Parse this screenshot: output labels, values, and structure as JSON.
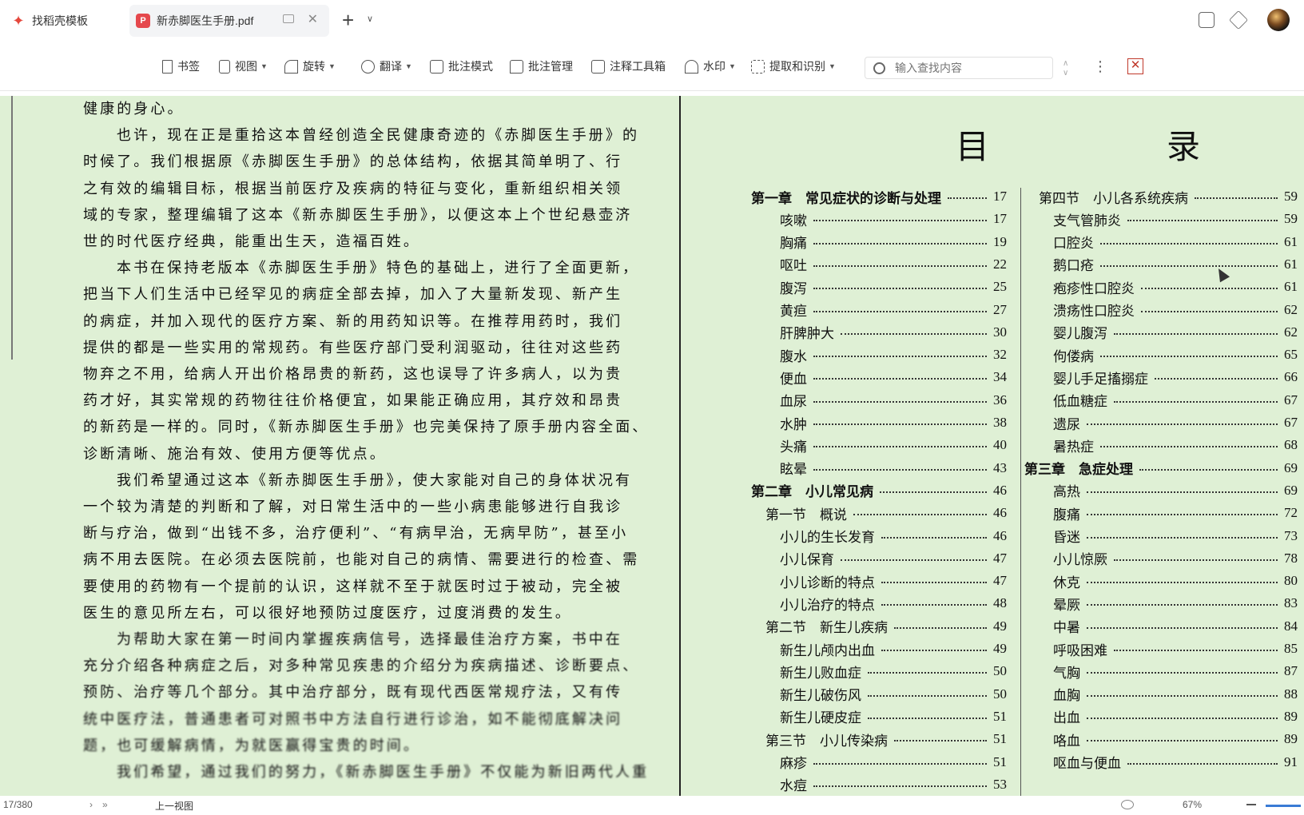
{
  "tabs": [
    {
      "label": "找稻壳模板"
    },
    {
      "label": "新赤脚医生手册.pdf"
    }
  ],
  "toolbar": {
    "bookmark": "书签",
    "view": "视图",
    "rotate": "旋转",
    "translate": "翻译",
    "annotate_mode": "批注模式",
    "annotate_manage": "批注管理",
    "annotate_tools": "注释工具箱",
    "watermark": "水印",
    "extract": "提取和识别",
    "search_placeholder": "输入查找内容"
  },
  "left_page": {
    "lines": [
      "健康的身心。",
      "也许，现在正是重拾这本曾经创造全民健康奇迹的《赤脚医生手册》的",
      "时候了。我们根据原《赤脚医生手册》的总体结构，依据其简单明了、行",
      "之有效的编辑目标，根据当前医疗及疾病的特征与变化，重新组织相关领",
      "域的专家，整理编辑了这本《新赤脚医生手册》，以便这本上个世纪悬壶济",
      "世的时代医疗经典，能重出生天，造福百姓。",
      "本书在保持老版本《赤脚医生手册》特色的基础上，进行了全面更新，",
      "把当下人们生活中已经罕见的病症全部去掉，加入了大量新发现、新产生",
      "的病症，并加入现代的医疗方案、新的用药知识等。在推荐用药时，我们",
      "提供的都是一些实用的常规药。有些医疗部门受利润驱动，往往对这些药",
      "物弃之不用，给病人开出价格昂贵的新药，这也误导了许多病人，以为贵",
      "药才好，其实常规的药物往往价格便宜，如果能正确应用，其疗效和昂贵",
      "的新药是一样的。同时，《新赤脚医生手册》也完美保持了原手册内容全面、",
      "诊断清晰、施治有效、使用方便等优点。",
      "我们希望通过这本《新赤脚医生手册》，使大家能对自己的身体状况有",
      "一个较为清楚的判断和了解，对日常生活中的一些小病患能够进行自我诊",
      "断与疗治，做到“出钱不多，治疗便利”、“有病早治，无病早防”，甚至小",
      "病不用去医院。在必须去医院前，也能对自己的病情、需要进行的检查、需",
      "要使用的药物有一个提前的认识，这样就不至于就医时过于被动，完全被",
      "医生的意见所左右，可以很好地预防过度医疗，过度消费的发生。",
      "为帮助大家在第一时间内掌握疾病信号，选择最佳治疗方案，书中在",
      "充分介绍各种病症之后，对多种常见疾患的介绍分为疾病描述、诊断要点、",
      "预防、治疗等几个部分。其中治疗部分，既有现代西医常规疗法，又有传",
      "统中医疗法，普通患者可对照书中方法自行进行诊治，如不能彻底解决问",
      "题，也可缓解病情，为就医赢得宝贵的时间。",
      "我们希望，通过我们的努力，《新赤脚医生手册》不仅能为新旧两代人重"
    ]
  },
  "right_page": {
    "title": "目　录",
    "toc_left": [
      {
        "label": "第一章　常见症状的诊断与处理",
        "page": "17",
        "chapter": true
      },
      {
        "label": "咳嗽",
        "page": "17"
      },
      {
        "label": "胸痛",
        "page": "19"
      },
      {
        "label": "呕吐",
        "page": "22"
      },
      {
        "label": "腹泻",
        "page": "25"
      },
      {
        "label": "黄疸",
        "page": "27"
      },
      {
        "label": "肝脾肿大",
        "page": "30"
      },
      {
        "label": "腹水",
        "page": "32"
      },
      {
        "label": "便血",
        "page": "34"
      },
      {
        "label": "血尿",
        "page": "36"
      },
      {
        "label": "水肿",
        "page": "38"
      },
      {
        "label": "头痛",
        "page": "40"
      },
      {
        "label": "眩晕",
        "page": "43"
      },
      {
        "label": "第二章　小儿常见病",
        "page": "46",
        "chapter": true
      },
      {
        "label": "第一节　概说",
        "page": "46"
      },
      {
        "label": "小儿的生长发育",
        "page": "46"
      },
      {
        "label": "小儿保育",
        "page": "47"
      },
      {
        "label": "小儿诊断的特点",
        "page": "47"
      },
      {
        "label": "小儿治疗的特点",
        "page": "48"
      },
      {
        "label": "第二节　新生儿疾病",
        "page": "49"
      },
      {
        "label": "新生儿颅内出血",
        "page": "49"
      },
      {
        "label": "新生儿败血症",
        "page": "50"
      },
      {
        "label": "新生儿破伤风",
        "page": "50"
      },
      {
        "label": "新生儿硬皮症",
        "page": "51"
      },
      {
        "label": "第三节　小儿传染病",
        "page": "51"
      },
      {
        "label": "麻疹",
        "page": "51"
      },
      {
        "label": "水痘",
        "page": "53"
      }
    ],
    "toc_right": [
      {
        "label": "第四节　小儿各系统疾病",
        "page": "59"
      },
      {
        "label": "支气管肺炎",
        "page": "59"
      },
      {
        "label": "口腔炎",
        "page": "61"
      },
      {
        "label": "鹅口疮",
        "page": "61"
      },
      {
        "label": "疱疹性口腔炎",
        "page": "61"
      },
      {
        "label": "溃疡性口腔炎",
        "page": "62"
      },
      {
        "label": "婴儿腹泻",
        "page": "62"
      },
      {
        "label": "佝偻病",
        "page": "65"
      },
      {
        "label": "婴儿手足搐搦症",
        "page": "66"
      },
      {
        "label": "低血糖症",
        "page": "67"
      },
      {
        "label": "遗尿",
        "page": "67"
      },
      {
        "label": "暑热症",
        "page": "68"
      },
      {
        "label": "第三章　急症处理",
        "page": "69",
        "chapter": true
      },
      {
        "label": "高热",
        "page": "69"
      },
      {
        "label": "腹痛",
        "page": "72"
      },
      {
        "label": "昏迷",
        "page": "73"
      },
      {
        "label": "小儿惊厥",
        "page": "78"
      },
      {
        "label": "休克",
        "page": "80"
      },
      {
        "label": "晕厥",
        "page": "83"
      },
      {
        "label": "中暑",
        "page": "84"
      },
      {
        "label": "呼吸困难",
        "page": "85"
      },
      {
        "label": "气胸",
        "page": "87"
      },
      {
        "label": "血胸",
        "page": "88"
      },
      {
        "label": "出血",
        "page": "89"
      },
      {
        "label": "咯血",
        "page": "89"
      },
      {
        "label": "呕血与便血",
        "page": "91"
      }
    ]
  },
  "statusbar": {
    "page_indicator": "17/380",
    "prev_view": "上一视图",
    "zoom": "67%"
  },
  "colors": {
    "doc_bg": "#dff0d5",
    "pdf_icon": "#e5484d"
  }
}
